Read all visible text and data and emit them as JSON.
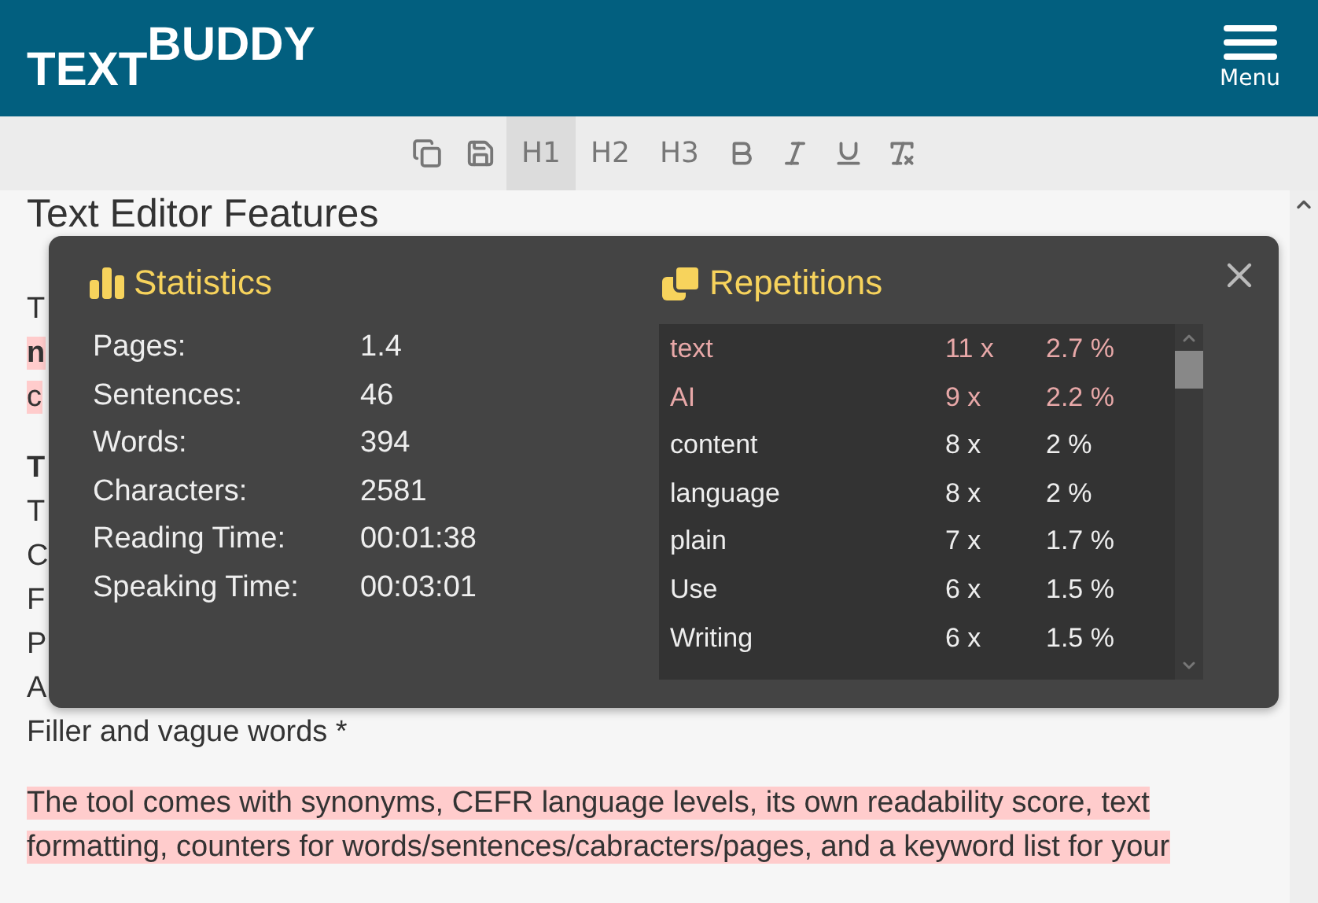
{
  "header": {
    "logo": {
      "main": "TEXT",
      "raised": "BUDDY"
    },
    "menu_label": "Menu"
  },
  "toolbar": {
    "items": [
      {
        "kind": "copy",
        "selected": false
      },
      {
        "kind": "save",
        "selected": false
      },
      {
        "kind": "heading",
        "label": "H1",
        "selected": true
      },
      {
        "kind": "heading",
        "label": "H2",
        "selected": false
      },
      {
        "kind": "heading",
        "label": "H3",
        "selected": false
      },
      {
        "kind": "bold",
        "selected": false
      },
      {
        "kind": "italic",
        "selected": false
      },
      {
        "kind": "underline",
        "selected": false
      },
      {
        "kind": "clear-format",
        "selected": false
      }
    ]
  },
  "editor": {
    "heading": "Text Editor Features",
    "paragraphs": [
      {
        "lines": [
          {
            "text": "T",
            "bold": false,
            "highlighted": false
          },
          {
            "text": "n",
            "bold": true,
            "highlighted": true
          },
          {
            "text": "c",
            "bold": false,
            "highlighted": true
          }
        ]
      },
      {
        "lines": [
          {
            "text": "T",
            "bold": true,
            "highlighted": false
          },
          {
            "text": "T",
            "bold": false,
            "highlighted": false
          },
          {
            "text": "C",
            "bold": false,
            "highlighted": false
          },
          {
            "text": "F",
            "bold": false,
            "highlighted": false
          },
          {
            "text": "P",
            "bold": false,
            "highlighted": false
          },
          {
            "text": "A",
            "bold": false,
            "highlighted": false
          },
          {
            "text": "Filler and vague words *",
            "bold": false,
            "highlighted": false
          }
        ]
      },
      {
        "lines": [
          {
            "text": "The tool comes with synonyms, CEFR language levels, its own readability score, text",
            "bold": false,
            "highlighted": true
          },
          {
            "text": "formatting, counters for words/sentences/cabracters/pages, and a keyword list for your",
            "bold": false,
            "highlighted": true
          }
        ]
      }
    ]
  },
  "dialog": {
    "statistics": {
      "title": "Statistics",
      "rows": [
        {
          "label": "Pages:",
          "value": "1.4"
        },
        {
          "label": "Sentences:",
          "value": "46"
        },
        {
          "label": "Words:",
          "value": "394"
        },
        {
          "label": "Characters:",
          "value": "2581"
        },
        {
          "label": "Reading Time:",
          "value": "00:01:38"
        },
        {
          "label": "Speaking Time:",
          "value": "00:03:01"
        }
      ]
    },
    "repetitions": {
      "title": "Repetitions",
      "rows": [
        {
          "word": "text",
          "count": "11 x",
          "percent": "2.7 %",
          "highlighted": true
        },
        {
          "word": "AI",
          "count": "9 x",
          "percent": "2.2 %",
          "highlighted": true
        },
        {
          "word": "content",
          "count": "8 x",
          "percent": "2 %",
          "highlighted": false
        },
        {
          "word": "language",
          "count": "8 x",
          "percent": "2 %",
          "highlighted": false
        },
        {
          "word": "plain",
          "count": "7 x",
          "percent": "1.7 %",
          "highlighted": false
        },
        {
          "word": "Use",
          "count": "6 x",
          "percent": "1.5 %",
          "highlighted": false
        },
        {
          "word": "Writing",
          "count": "6 x",
          "percent": "1.5 %",
          "highlighted": false
        }
      ]
    }
  }
}
